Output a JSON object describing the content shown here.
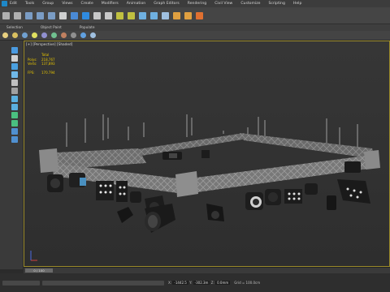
{
  "menu": {
    "items": [
      "Edit",
      "Tools",
      "Group",
      "Views",
      "Create",
      "Modifiers",
      "Animation",
      "Graph Editors",
      "Rendering",
      "Civil View",
      "Customize",
      "Scripting",
      "Help"
    ]
  },
  "ribbon": {
    "tabs": [
      "Selection",
      "Object Paint",
      "Populate"
    ]
  },
  "toolbar": {
    "buttons": [
      {
        "icon": "undo-icon",
        "color": "#b0b0b0"
      },
      {
        "icon": "redo-icon",
        "color": "#b0b0b0"
      },
      {
        "icon": "link-icon",
        "color": "#7a9cc4"
      },
      {
        "icon": "unlink-icon",
        "color": "#7a9cc4"
      },
      {
        "icon": "bind-icon",
        "color": "#7a9cc4"
      },
      {
        "icon": "select-icon",
        "color": "#d0d0d0"
      },
      {
        "icon": "select-region-icon",
        "color": "#4a8ad6"
      },
      {
        "icon": "move-icon",
        "color": "#2f8be0"
      },
      {
        "icon": "rotate-icon",
        "color": "#c8c8c8"
      },
      {
        "icon": "scale-icon",
        "color": "#c8c8c8"
      },
      {
        "icon": "snap-icon",
        "color": "#c0c040"
      },
      {
        "icon": "angle-snap-icon",
        "color": "#c0c040"
      },
      {
        "icon": "mirror-icon",
        "color": "#6fb0e0"
      },
      {
        "icon": "align-icon",
        "color": "#6fb0e0"
      },
      {
        "icon": "layer-icon",
        "color": "#9fc0e0"
      },
      {
        "icon": "render-setup-icon",
        "color": "#e0a040"
      },
      {
        "icon": "render-frame-icon",
        "color": "#e0a040"
      },
      {
        "icon": "render-icon",
        "color": "#e07030"
      }
    ]
  },
  "toolbar2": {
    "buttons": [
      {
        "icon": "sphere-icon",
        "color": "#e8d080"
      },
      {
        "icon": "cube-icon",
        "color": "#d9c060"
      },
      {
        "icon": "shape-icon",
        "color": "#70a0d0"
      },
      {
        "icon": "light-icon",
        "color": "#e0e060"
      },
      {
        "icon": "camera-icon",
        "color": "#9090d0"
      },
      {
        "icon": "helper-icon",
        "color": "#70c090"
      },
      {
        "icon": "space-warp-icon",
        "color": "#c08060"
      },
      {
        "icon": "system-icon",
        "color": "#909090"
      },
      {
        "icon": "material-icon",
        "color": "#60a0e0"
      },
      {
        "icon": "environment-icon",
        "color": "#a0c0e0"
      }
    ]
  },
  "left_tools": [
    {
      "icon": "select-object-icon",
      "color": "#4a9ae0"
    },
    {
      "icon": "move-tool-icon",
      "color": "#d0d0d0"
    },
    {
      "icon": "rotate-tool-icon",
      "color": "#4aa0e0"
    },
    {
      "icon": "scale-tool-icon",
      "color": "#6fb8e8"
    },
    {
      "icon": "paint-icon",
      "color": "#c0c0c0"
    },
    {
      "icon": "freeform-icon",
      "color": "#a0a0a0"
    },
    {
      "icon": "graphite-icon",
      "color": "#5ab0e0"
    },
    {
      "icon": "selection-tool-icon",
      "color": "#5ab0e0"
    },
    {
      "icon": "object-paint-icon",
      "color": "#4ac080"
    },
    {
      "icon": "populate-icon",
      "color": "#4ac080"
    },
    {
      "icon": "path-icon",
      "color": "#5090d0"
    },
    {
      "icon": "loop-icon",
      "color": "#5090d0"
    }
  ],
  "viewport": {
    "label": "[+] [Perspective] [Shaded]",
    "stats": {
      "header": "Total",
      "polys_label": "Polys:",
      "polys": "218,767",
      "verts_label": "Verts:",
      "verts": "137,893",
      "fps_label": "FPS:",
      "fps": "170.794"
    }
  },
  "timeline": {
    "frame_label": "0 / 100"
  },
  "status": {
    "x_label": "X:",
    "x": "-1442.5",
    "y_label": "Y:",
    "y": "-302.3m",
    "z_label": "Z:",
    "z": "0.0mm",
    "grid_label": "Grid = 100.0cm"
  },
  "colors": {
    "truss": "#8a8a8a",
    "truss_dark": "#5c5c5c",
    "light_body": "#1c1c1c",
    "active_border": "#9a8a2a"
  }
}
